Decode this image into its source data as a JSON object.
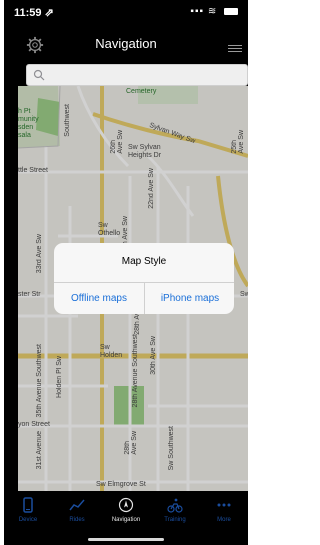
{
  "status_bar": {
    "time": "11:59 ⇗",
    "signal": "▪▪▪ ≋"
  },
  "nav": {
    "title": "Navigation"
  },
  "search": {
    "placeholder": ""
  },
  "map": {
    "labels": {
      "cemetery": "Cemetery",
      "community": "h Pt\nmunity\nsden\nsala",
      "southwest": "Southwest",
      "sylvan_way": "Sylvan Way Sw",
      "sw_sylvan": "Sw Sylvan\nHeights Dr",
      "st_26th": "26th\nAve Sw",
      "st_22nd": "22nd Ave Sw",
      "ave_29th": "29th Ave Sw",
      "ave_25th": "25th\nAve Sw",
      "little_street": "ttle Street",
      "ave_33rd": "33rd Ave Sw",
      "sw_othello": "Sw\nOthello",
      "ave_28th": "28th Ave Sw",
      "sw_holden": "Sw\nHolden",
      "ave_28th_sw": "28th Avenue Southwest",
      "ave_35th": "35th Avenue Southwest",
      "holden_pl": "Holden Pl Sw",
      "ave_30th": "30th Ave Sw",
      "ave_31st": "31st Avenue",
      "yon_street": "yon Street",
      "ave_28th_b": "28th\nAve Sw",
      "sw_southwest": "Sw Southwest",
      "sw_elmgrove": "Sw Elmgrove St",
      "ster_st": "ster Str",
      "sw_right": "Sw"
    }
  },
  "alert": {
    "title": "Map Style",
    "offline": "Offline maps",
    "iphone": "iPhone maps"
  },
  "tabs": [
    {
      "label": "Device",
      "icon": "phone-icon"
    },
    {
      "label": "Rides",
      "icon": "chart-icon"
    },
    {
      "label": "Navigation",
      "icon": "compass-icon"
    },
    {
      "label": "Training",
      "icon": "cyclist-icon"
    },
    {
      "label": "More",
      "icon": "more-icon"
    }
  ],
  "colors": {
    "accent": "#1a6fd8",
    "tab_inactive": "#1a4d9e",
    "map_bg": "#f1efe9",
    "road_major": "#e9cf6d"
  }
}
